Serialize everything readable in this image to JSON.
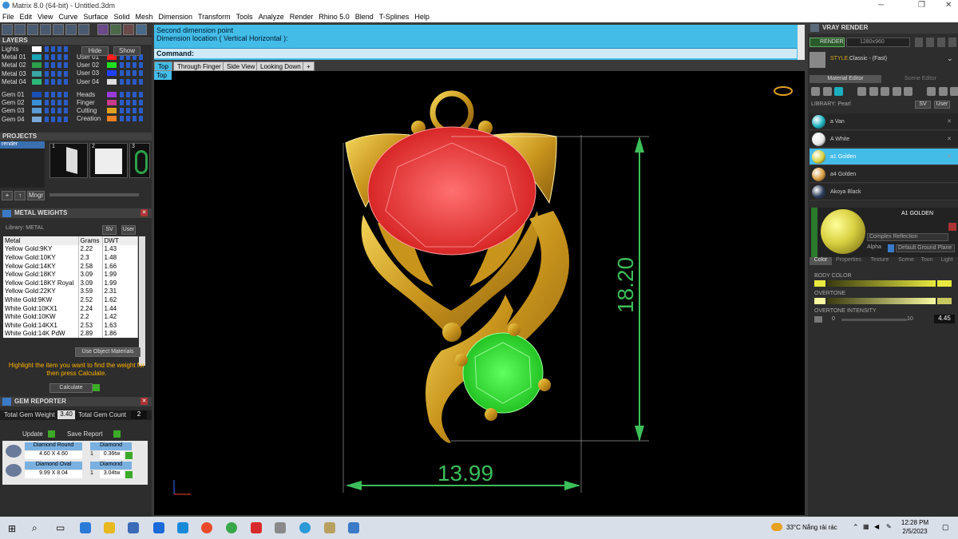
{
  "window": {
    "title": "Matrix 8.0 (64-bit) - Untitled.3dm",
    "min": "─",
    "restore": "❐",
    "close": "✕"
  },
  "menu": [
    "File",
    "Edit",
    "View",
    "Curve",
    "Surface",
    "Solid",
    "Mesh",
    "Dimension",
    "Transform",
    "Tools",
    "Analyze",
    "Render",
    "Rhino 5.0",
    "Blend",
    "T-Splines",
    "Help"
  ],
  "layers": {
    "title": "LAYERS",
    "hide": "Hide",
    "show": "Show",
    "left": [
      {
        "name": "Lights",
        "color": "#ffffff"
      },
      {
        "name": "Metal 01",
        "color": "#1aa6b5"
      },
      {
        "name": "Metal 02",
        "color": "#2ca04a"
      },
      {
        "name": "Metal 03",
        "color": "#3aa6a6"
      },
      {
        "name": "Metal 04",
        "color": "#2cba7a"
      },
      {
        "name": "Gem 01",
        "color": "#1a4fb8"
      },
      {
        "name": "Gem 02",
        "color": "#3a8fd8"
      },
      {
        "name": "Gem 03",
        "color": "#5a9ad8"
      },
      {
        "name": "Gem 04",
        "color": "#7aa8d8"
      }
    ],
    "right": [
      {
        "name": "User 01",
        "color": "#ff2020"
      },
      {
        "name": "User 02",
        "color": "#20e020"
      },
      {
        "name": "User 03",
        "color": "#2040ff"
      },
      {
        "name": "User 04",
        "color": "#e0e0e0"
      },
      {
        "name": "Heads",
        "color": "#9a3ad8"
      },
      {
        "name": "Finger",
        "color": "#c83a8a"
      },
      {
        "name": "Cutting",
        "color": "#e0a020"
      },
      {
        "name": "Creation",
        "color": "#f08020"
      }
    ]
  },
  "projects": {
    "title": "PROJECTS",
    "item": "render",
    "thumbs": [
      "1",
      "2",
      "3"
    ],
    "mngr": "Mngr"
  },
  "metal_weights": {
    "title": "METAL WEIGHTS",
    "library": "Library: METAL",
    "lib_btns": [
      "SV",
      "User"
    ],
    "headers": [
      "Metal",
      "Grams",
      "DWT"
    ],
    "rows": [
      [
        "Yellow Gold:9KY",
        "2.22",
        "1.43"
      ],
      [
        "Yellow Gold:10KY",
        "2.3",
        "1.48"
      ],
      [
        "Yellow Gold:14KY",
        "2.58",
        "1.66"
      ],
      [
        "Yellow Gold:18KY",
        "3.09",
        "1.99"
      ],
      [
        "Yellow Gold:18KY Royal",
        "3.09",
        "1.99"
      ],
      [
        "Yellow Gold:22KY",
        "3.59",
        "2.31"
      ],
      [
        "White Gold:9KW",
        "2.52",
        "1.62"
      ],
      [
        "White Gold:10KX1",
        "2.24",
        "1.44"
      ],
      [
        "White Gold:10KW",
        "2.2",
        "1.42"
      ],
      [
        "White Gold:14KX1",
        "2.53",
        "1.63"
      ],
      [
        "White Gold:14K PdW",
        "2.89",
        "1.86"
      ]
    ],
    "use_object": "Use Object Materials",
    "hint": "Highlight the item you want to find the weight for then press Calculate.",
    "calculate": "Calculate"
  },
  "gem_reporter": {
    "title": "GEM REPORTER",
    "total_weight_label": "Total Gem Weight",
    "total_weight": "3.40",
    "total_count_label": "Total Gem Count",
    "total_count": "2",
    "update": "Update",
    "save": "Save Report",
    "gems": [
      {
        "shape": "Diamond Round",
        "type": "Diamond",
        "size": "4.60 X 4.60",
        "qty": "1",
        "ctw": "0.36tw"
      },
      {
        "shape": "Diamond Oval",
        "type": "Diamond",
        "size": "9.99 X 8.04",
        "qty": "1",
        "ctw": "3.04tw"
      }
    ]
  },
  "command": {
    "line1": "Second dimension point",
    "line2": "Dimension location ( Vertical  Horizontal ):",
    "label": "Command:"
  },
  "view_tabs": [
    "Top",
    "Through Finger",
    "Side View",
    "Looking Down",
    "+"
  ],
  "view_sub": "Top",
  "dimensions": {
    "width": "13.99",
    "height": "18.20"
  },
  "vray": {
    "title": "VRAY RENDER",
    "render": "RENDER",
    "resolution": "1280x960",
    "style_label": "STYLE:",
    "style": "Classic - (Fast)",
    "tabs": [
      "Material Editor",
      "Scene Editor"
    ],
    "library": "LIBRARY: Pearl",
    "lib_btns": [
      "SV",
      "User"
    ],
    "materials": [
      {
        "name": "a Van",
        "color": "#1ab0c0"
      },
      {
        "name": "A White",
        "color": "#e8e8e8"
      },
      {
        "name": "a1 Golden",
        "color": "#d8d040"
      },
      {
        "name": "a4 Golden",
        "color": "#d89a40"
      },
      {
        "name": "Akoya Black",
        "color": "#2a3a5a"
      }
    ],
    "selected_title": "A1 GOLDEN",
    "reflection": "Complex Reflection",
    "alpha": "Alpha",
    "ground": "Default Ground Plane",
    "prop_tabs": [
      "Color",
      "Properties",
      "Texture",
      "Scene",
      "Toon",
      "Light"
    ],
    "body_color": "BODY COLOR",
    "overtone": "OVERTONE",
    "overtone_intensity": "OVERTONE INTENSITY",
    "intensity_min": "0",
    "intensity_max": "10",
    "intensity_value": "4.45",
    "body_color_hex": "#e8e840",
    "overtone_hex": "#f8f8a0"
  },
  "taskbar": {
    "weather": "33°C  Nắng rải rác",
    "time": "12:28 PM",
    "date": "2/5/2023"
  }
}
